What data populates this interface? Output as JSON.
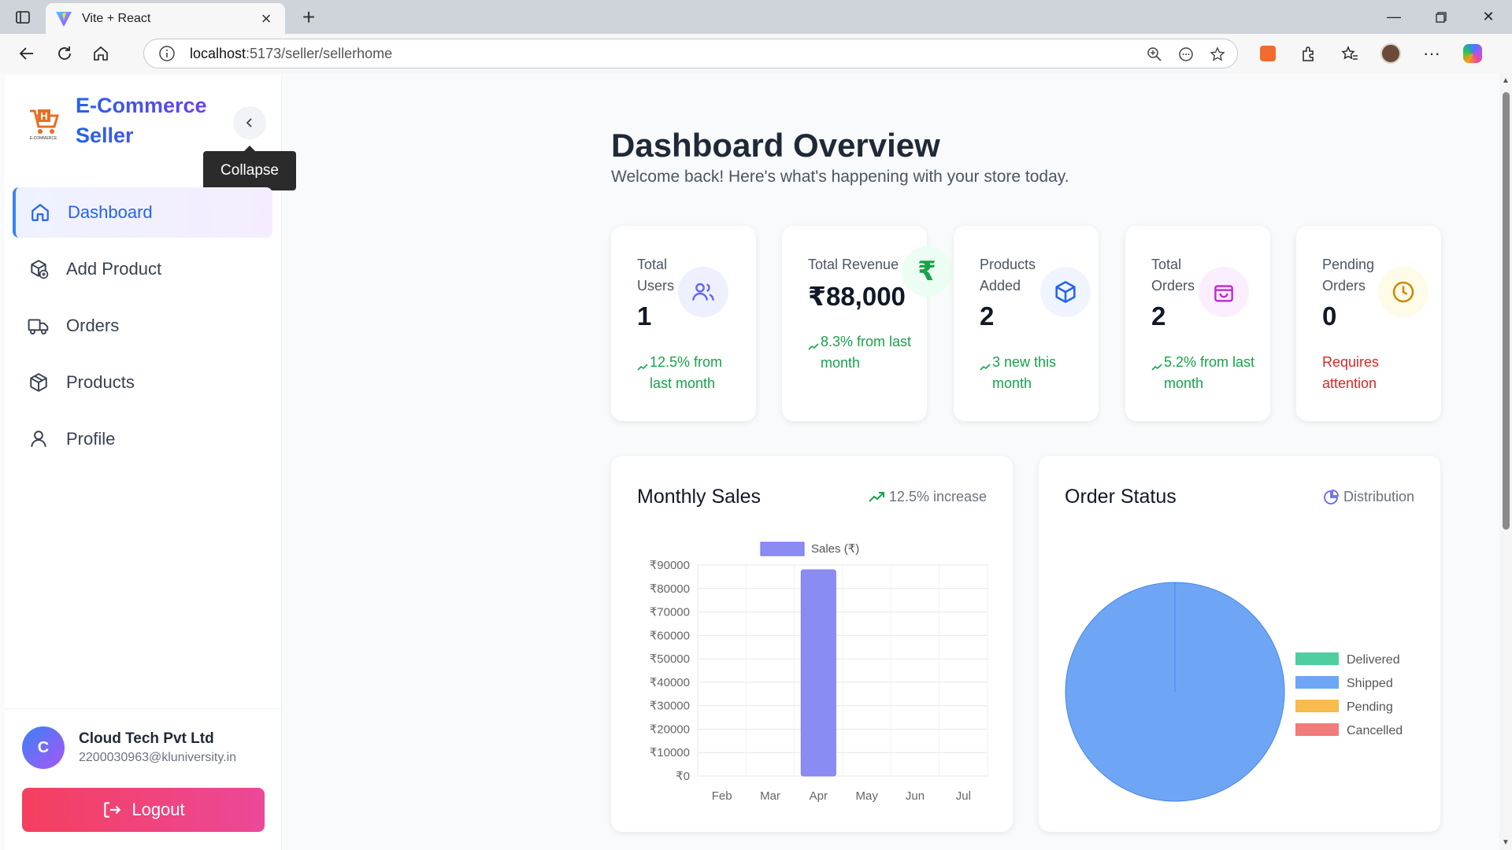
{
  "browser": {
    "tab_title": "Vite + React",
    "address_host": "localhost",
    "address_path": ":5173/seller/sellerhome"
  },
  "sidebar": {
    "brand_line1": "E-Commerce",
    "brand_line2": "Seller",
    "tooltip": "Collapse",
    "items": [
      {
        "label": "Dashboard",
        "icon": "home-icon",
        "active": true
      },
      {
        "label": "Add Product",
        "icon": "package-plus-icon",
        "active": false
      },
      {
        "label": "Orders",
        "icon": "truck-icon",
        "active": false
      },
      {
        "label": "Products",
        "icon": "package-icon",
        "active": false
      },
      {
        "label": "Profile",
        "icon": "user-icon",
        "active": false
      }
    ],
    "user": {
      "initial": "C",
      "name": "Cloud Tech Pvt Ltd",
      "email": "2200030963@kluniversity.in"
    },
    "logout_label": "Logout"
  },
  "main": {
    "title": "Dashboard Overview",
    "subtitle": "Welcome back! Here's what's happening with your store today.",
    "stats": [
      {
        "label": "Total Users",
        "value": "1",
        "change": "12.5% from last month",
        "tone": "green",
        "icon": "users-icon",
        "icon_color": "#6366f1",
        "icon_bg": "#eef0ff"
      },
      {
        "label": "Total Revenue",
        "value": "₹88,000",
        "change": "8.3% from last month",
        "tone": "green",
        "icon": "rupee-icon",
        "icon_color": "#16a34a",
        "icon_bg": "#ecfdf3"
      },
      {
        "label": "Products Added",
        "value": "2",
        "change": "3 new this month",
        "tone": "green",
        "icon": "box-icon",
        "icon_color": "#2563eb",
        "icon_bg": "#eff4ff"
      },
      {
        "label": "Total Orders",
        "value": "2",
        "change": "5.2% from last month",
        "tone": "green",
        "icon": "shopping-bag-icon",
        "icon_color": "#c026d3",
        "icon_bg": "#fbefff"
      },
      {
        "label": "Pending Orders",
        "value": "0",
        "change": "Requires attention",
        "tone": "red",
        "icon": "clock-icon",
        "icon_color": "#ca8a04",
        "icon_bg": "#fefbe8"
      }
    ],
    "sales_card": {
      "title": "Monthly Sales",
      "meta": "12.5% increase"
    },
    "status_card": {
      "title": "Order Status",
      "meta": "Distribution"
    }
  },
  "chart_data": [
    {
      "type": "bar",
      "title": "",
      "xlabel": "",
      "ylabel": "",
      "categories": [
        "Feb",
        "Mar",
        "Apr",
        "May",
        "Jun",
        "Jul"
      ],
      "series": [
        {
          "name": "Sales (₹)",
          "values": [
            0,
            0,
            88000,
            0,
            0,
            0
          ],
          "color": "#8b8cf3"
        }
      ],
      "ylim": [
        0,
        90000
      ],
      "yticks": [
        "₹0",
        "₹10000",
        "₹20000",
        "₹30000",
        "₹40000",
        "₹50000",
        "₹60000",
        "₹70000",
        "₹80000",
        "₹90000"
      ],
      "legend": "top",
      "grid": true
    },
    {
      "type": "pie",
      "title": "",
      "labels": [
        "Delivered",
        "Shipped",
        "Pending",
        "Cancelled"
      ],
      "values": [
        0,
        2,
        0,
        0
      ],
      "colors": [
        "#4fcf9f",
        "#6ea6f5",
        "#f7bb4e",
        "#f27b7b"
      ],
      "legend": "right"
    }
  ]
}
